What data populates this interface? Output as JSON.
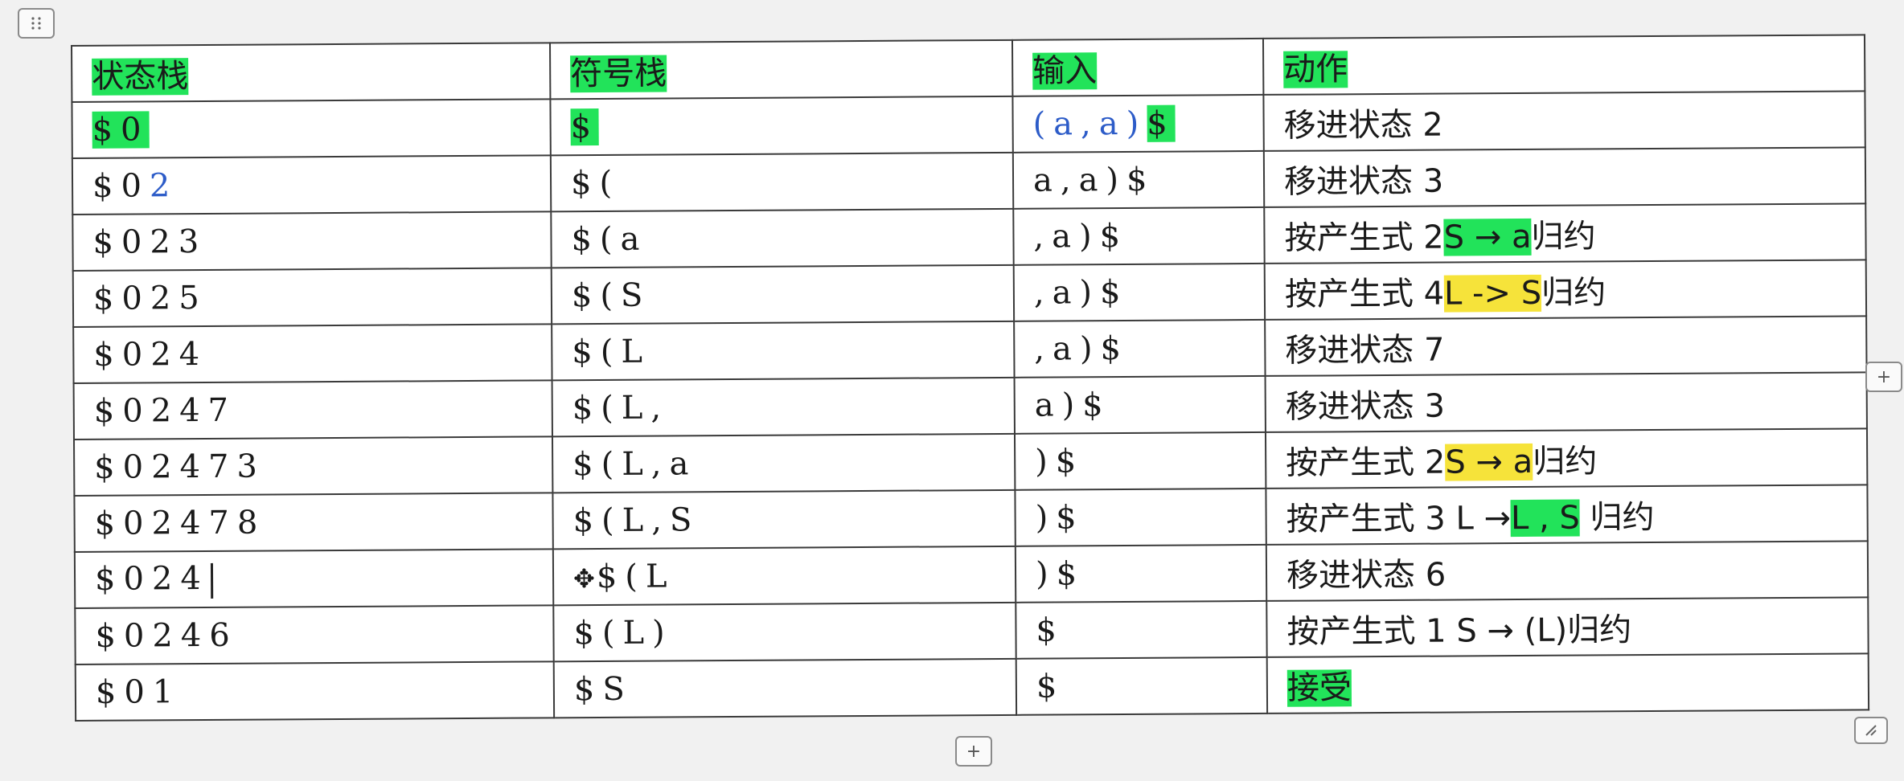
{
  "headers": [
    "状态栈",
    "符号栈",
    "输入",
    "动作"
  ],
  "rows": [
    {
      "state": "$0",
      "symbol": "$",
      "input_pre": "(a,a)",
      "input_post": "$",
      "action": "移进状态 2"
    },
    {
      "state_pre": "$0",
      "state_post": "2",
      "symbol": "$(",
      "input": "a,a)$",
      "action": "移进状态 3"
    },
    {
      "state": "$023",
      "symbol": "$(a",
      "input": ",a)$",
      "action_pre": "按产生式 2",
      "action_hl": "S → a",
      "action_post": "归约"
    },
    {
      "state": "$025",
      "symbol": "$(S",
      "input": ",a)$",
      "action_pre": "按产生式 4",
      "action_hl": "L -> S",
      "action_post": "归约"
    },
    {
      "state": "$024",
      "symbol": "$(L",
      "input": ",a)$",
      "action": "移进状态 7"
    },
    {
      "state": "$0247",
      "symbol": "$(L,",
      "input": "a)$",
      "action": "移进状态 3"
    },
    {
      "state": "$02473",
      "symbol": "$(L,a",
      "input": ")$",
      "action_pre": "按产生式 2",
      "action_hl": "S → a",
      "action_post": "归约"
    },
    {
      "state": "$02478",
      "symbol": "$(L,S",
      "input": ")$",
      "action_pre": "按产生式 3 L →",
      "action_hl": "L , S",
      "action_post": "归约"
    },
    {
      "state": "$024",
      "symbol": "$(L",
      "input": ")$",
      "action": "移进状态 6"
    },
    {
      "state": "$0246",
      "symbol": "$(L)",
      "input": "$",
      "action": "按产生式 1 S → (L)归约"
    },
    {
      "state": "$01",
      "symbol": "$S",
      "input": "$",
      "action": "接受"
    }
  ],
  "controls": {
    "add_label": "+"
  },
  "colors": {
    "green_highlight": "#22e35a",
    "yellow_highlight": "#f6e33a",
    "blue_text": "#2d5cc8"
  },
  "icons": {
    "move_handle": "table-move-handle-icon",
    "resize_handle": "table-resize-handle-icon"
  }
}
